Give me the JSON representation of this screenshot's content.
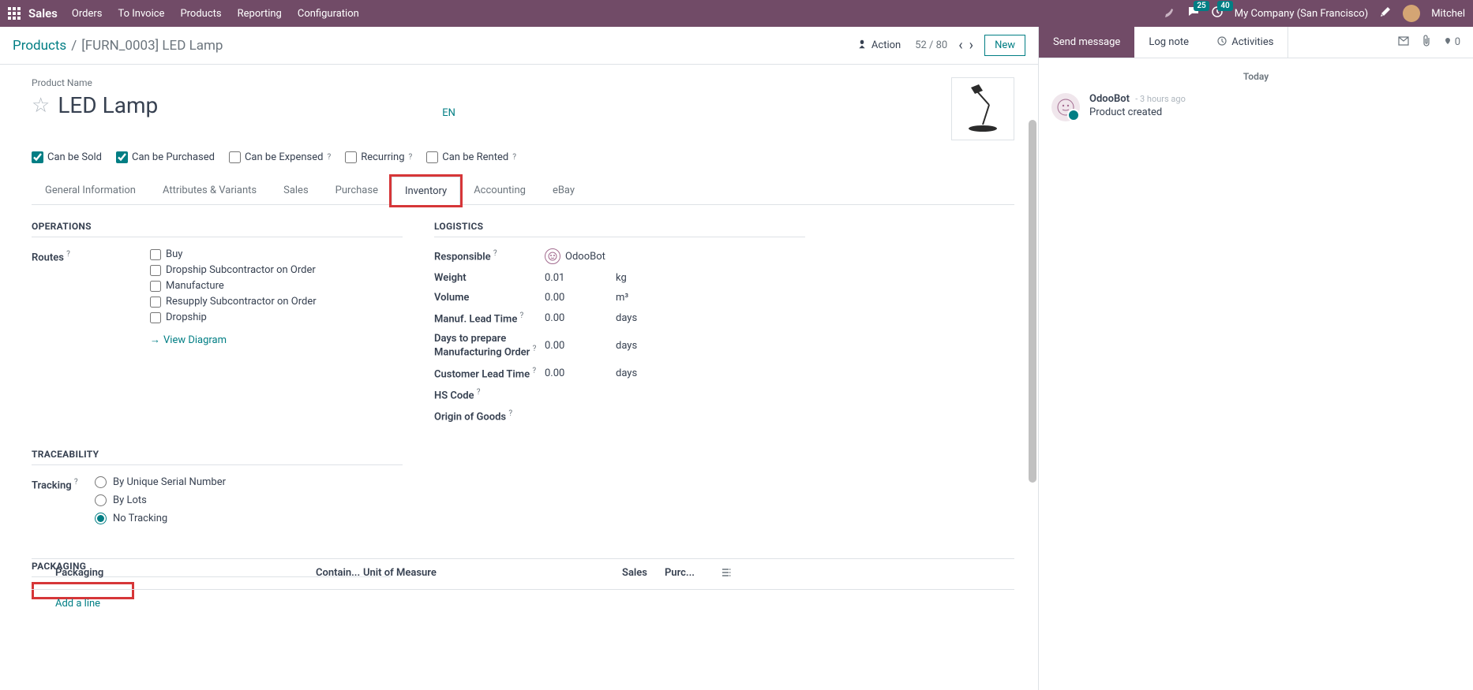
{
  "topbar": {
    "brand": "Sales",
    "nav": [
      "Orders",
      "To Invoice",
      "Products",
      "Reporting",
      "Configuration"
    ],
    "badge_messages": "25",
    "badge_activities": "40",
    "company": "My Company (San Francisco)",
    "user": "Mitchel"
  },
  "breadcrumb": {
    "root": "Products",
    "current": "[FURN_0003] LED Lamp",
    "action": "Action",
    "pager": "52 / 80",
    "new": "New"
  },
  "product": {
    "label": "Product Name",
    "name": "LED Lamp",
    "lang": "EN"
  },
  "options": {
    "sold": "Can be Sold",
    "purchased": "Can be Purchased",
    "expensed": "Can be Expensed",
    "recurring": "Recurring",
    "rented": "Can be Rented"
  },
  "tabs": [
    "General Information",
    "Attributes & Variants",
    "Sales",
    "Purchase",
    "Inventory",
    "Accounting",
    "eBay"
  ],
  "operations": {
    "title": "OPERATIONS",
    "routes_label": "Routes",
    "routes": [
      "Buy",
      "Dropship Subcontractor on Order",
      "Manufacture",
      "Resupply Subcontractor on Order",
      "Dropship"
    ],
    "view_diagram": "View Diagram"
  },
  "logistics": {
    "title": "LOGISTICS",
    "responsible_label": "Responsible",
    "responsible_value": "OdooBot",
    "rows": [
      {
        "label": "Weight",
        "value": "0.01",
        "unit": "kg",
        "help": false
      },
      {
        "label": "Volume",
        "value": "0.00",
        "unit": "m³",
        "help": false
      },
      {
        "label": "Manuf. Lead Time",
        "value": "0.00",
        "unit": "days",
        "help": true
      },
      {
        "label": "Days to prepare Manufacturing Order",
        "value": "0.00",
        "unit": "days",
        "help": true
      },
      {
        "label": "Customer Lead Time",
        "value": "0.00",
        "unit": "days",
        "help": true
      }
    ],
    "hs_code": "HS Code",
    "origin": "Origin of Goods"
  },
  "traceability": {
    "title": "TRACEABILITY",
    "tracking_label": "Tracking",
    "options": [
      "By Unique Serial Number",
      "By Lots",
      "No Tracking"
    ]
  },
  "packaging": {
    "title": "PACKAGING",
    "cols": {
      "c1": "Packaging",
      "c2": "Contain...",
      "c3": "Unit of Measure",
      "c4": "Sales",
      "c5": "Purc..."
    },
    "add_line": "Add a line"
  },
  "chatter": {
    "send": "Send message",
    "log": "Log note",
    "activities": "Activities",
    "follower_count": "0",
    "date": "Today",
    "message": {
      "author": "OdooBot",
      "time": "- 3 hours ago",
      "body": "Product created"
    }
  }
}
